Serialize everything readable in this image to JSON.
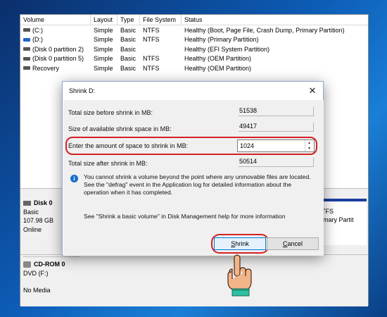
{
  "volume_list": {
    "headers": [
      "Volume",
      "Layout",
      "Type",
      "File System",
      "Status"
    ],
    "rows": [
      {
        "volume": "(C:)",
        "layout": "Simple",
        "type": "Basic",
        "fs": "NTFS",
        "status": "Healthy (Boot, Page File, Crash Dump, Primary Partition)"
      },
      {
        "volume": "(D:)",
        "layout": "Simple",
        "type": "Basic",
        "fs": "NTFS",
        "status": "Healthy (Primary Partition)"
      },
      {
        "volume": "(Disk 0 partition 2)",
        "layout": "Simple",
        "type": "Basic",
        "fs": "",
        "status": "Healthy (EFI System Partition)"
      },
      {
        "volume": "(Disk 0 partition 5)",
        "layout": "Simple",
        "type": "Basic",
        "fs": "NTFS",
        "status": "Healthy (OEM Partition)"
      },
      {
        "volume": "Recovery",
        "layout": "Simple",
        "type": "Basic",
        "fs": "NTFS",
        "status": "Healthy (OEM Partition)"
      }
    ]
  },
  "disks": {
    "disk0": {
      "name": "Disk 0",
      "type": "Basic",
      "size": "107.98 GB",
      "status": "Online"
    },
    "cdrom": {
      "name": "CD-ROM 0",
      "drive": "DVD (F:)",
      "media": "No Media"
    },
    "partition_right": {
      "fs": "TFS",
      "status": "imary Partit"
    }
  },
  "dialog": {
    "title": "Shrink D:",
    "total_before_label": "Total size before shrink in MB:",
    "total_before_value": "51538",
    "available_label": "Size of available shrink space in MB:",
    "available_value": "49417",
    "enter_label": "Enter the amount of space to shrink in MB:",
    "enter_value": "1024",
    "total_after_label": "Total size after shrink in MB:",
    "total_after_value": "50514",
    "info_text": "You cannot shrink a volume beyond the point where any unmovable files are located. See the \"defrag\" event in the Application log for detailed information about the operation when it has completed.",
    "help_text": "See \"Shrink a basic volume\" in Disk Management help for more information",
    "shrink_button": "Shrink",
    "cancel_button": "Cancel"
  },
  "colors": {
    "highlight_oval": "#d42027",
    "accent": "#0078d7",
    "disk_bar": "#1b3f9e"
  }
}
